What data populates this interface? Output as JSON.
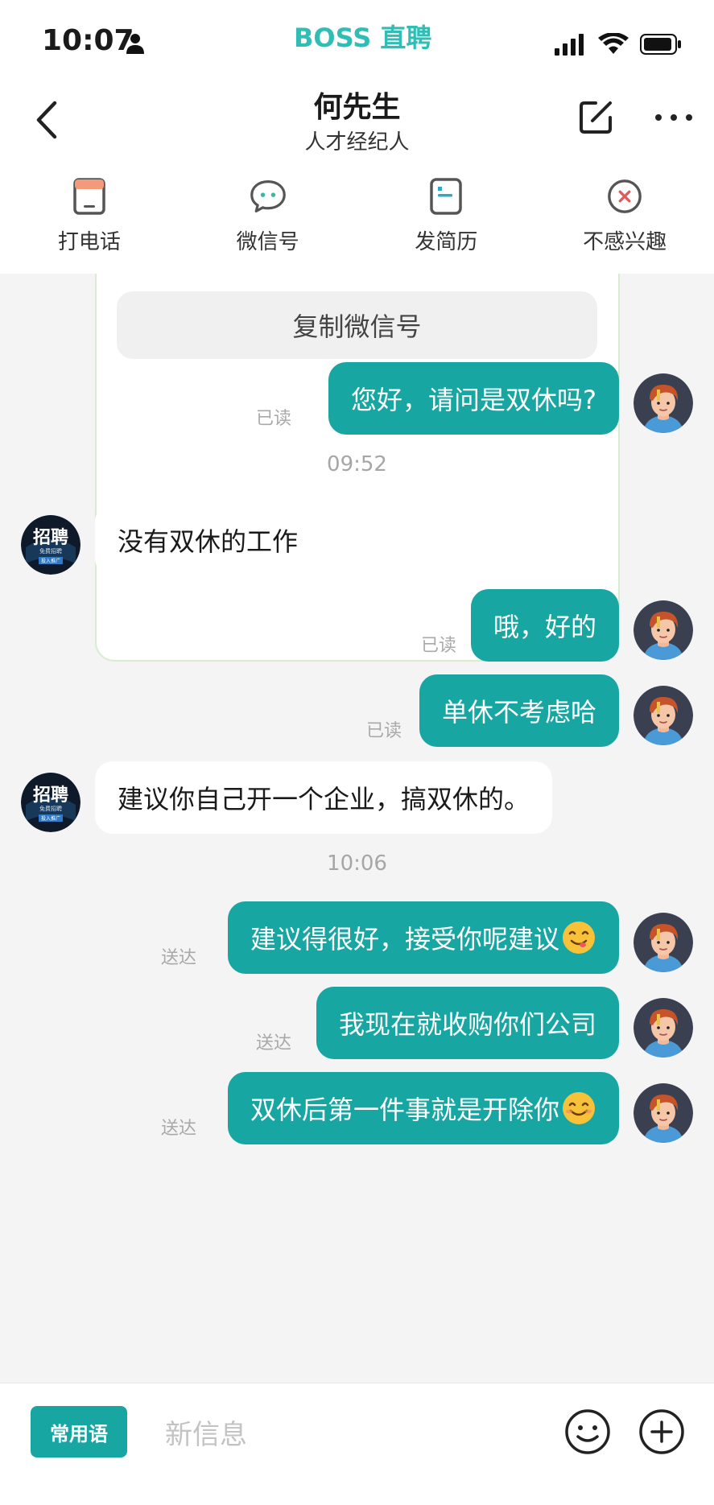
{
  "status_bar": {
    "time": "10:07",
    "brand": "BOSS 直聘"
  },
  "header": {
    "name": "何先生",
    "subtitle": "人才经纪人"
  },
  "actions": [
    {
      "label": "打电话",
      "icon": "phone-icon"
    },
    {
      "label": "微信号",
      "icon": "chat-bubble-icon"
    },
    {
      "label": "发简历",
      "icon": "resume-icon"
    },
    {
      "label": "不感兴趣",
      "icon": "not-interested-icon"
    }
  ],
  "wechat_card": {
    "copy_label": "复制微信号"
  },
  "messages": [
    {
      "from": "me",
      "text": "您好，请问是双休吗?",
      "status": "已读"
    },
    {
      "type": "time",
      "text": "09:52"
    },
    {
      "from": "other",
      "text": "没有双休的工作"
    },
    {
      "from": "me",
      "text": "哦，好的",
      "status": "已读"
    },
    {
      "from": "me",
      "text": "单休不考虑哈",
      "status": "已读"
    },
    {
      "from": "other",
      "text": "建议你自己开一个企业，搞双休的。"
    },
    {
      "type": "time",
      "text": "10:06"
    },
    {
      "from": "me",
      "text": "建议得很好，接受你呢建议",
      "emoji": "yum-face",
      "status": "送达"
    },
    {
      "from": "me",
      "text": "我现在就收购你们公司",
      "status": "送达"
    },
    {
      "from": "me",
      "text": "双休后第一件事就是开除你",
      "emoji": "smile-face",
      "status": "送达"
    }
  ],
  "input": {
    "phrases_label": "常用语",
    "placeholder": "新信息"
  },
  "other_avatar": {
    "text_line1": "招聘",
    "text_line2": "免费招聘",
    "text_line3": "投入推广"
  },
  "colors": {
    "accent": "#17a6a2",
    "brand": "#2fbdb6",
    "background": "#f4f4f5"
  }
}
